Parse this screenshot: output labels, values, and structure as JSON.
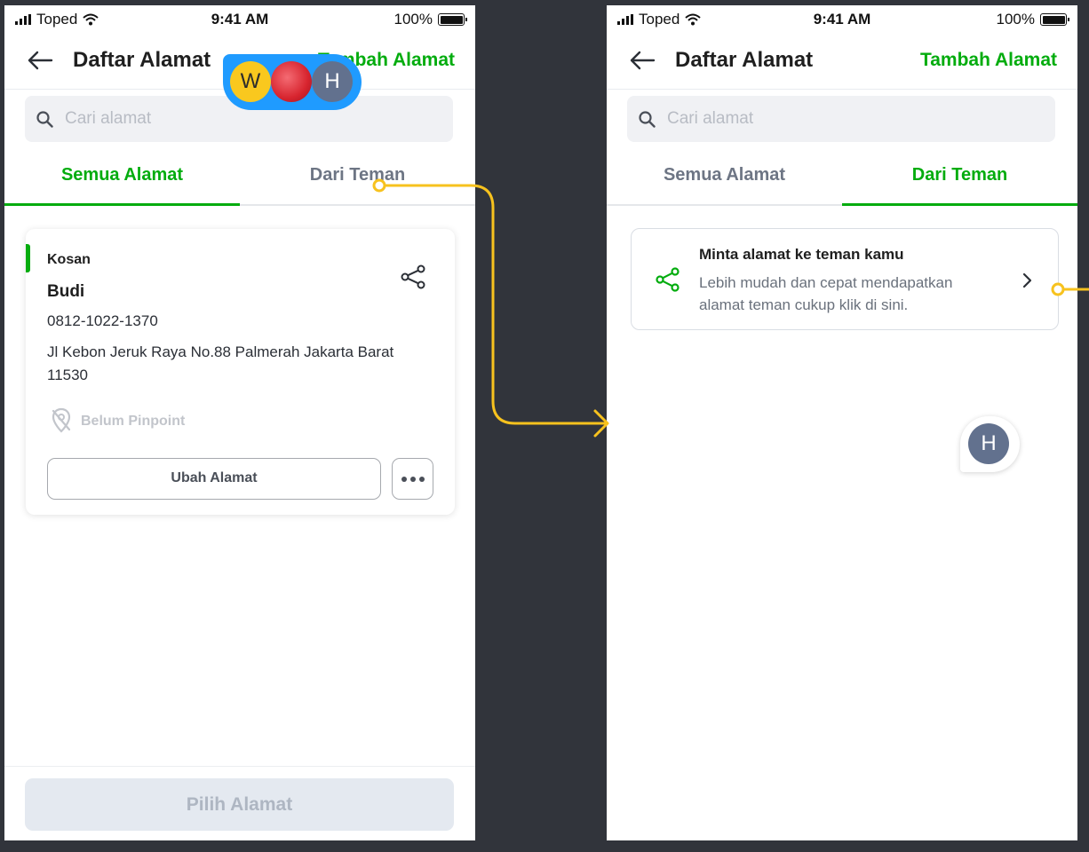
{
  "status_bar": {
    "carrier": "Toped",
    "time": "9:41 AM",
    "battery": "100%"
  },
  "screen1": {
    "title": "Daftar Alamat",
    "add_link": "Tambah Alamat",
    "search_placeholder": "Cari alamat",
    "tabs": [
      {
        "label": "Semua Alamat",
        "active": true
      },
      {
        "label": "Dari Teman",
        "active": false
      }
    ],
    "address_card": {
      "label": "Kosan",
      "name": "Budi",
      "phone": "0812-1022-1370",
      "street": "Jl Kebon Jeruk Raya No.88 Palmerah Jakarta Barat 11530",
      "pinpoint_status": "Belum Pinpoint",
      "edit_button": "Ubah Alamat"
    },
    "primary_button": "Pilih Alamat",
    "avatars": [
      "W",
      "",
      "H"
    ]
  },
  "screen2": {
    "title": "Daftar Alamat",
    "add_link": "Tambah Alamat",
    "search_placeholder": "Cari alamat",
    "tabs": [
      {
        "label": "Semua Alamat",
        "active": false
      },
      {
        "label": "Dari Teman",
        "active": true
      }
    ],
    "request_card": {
      "title": "Minta alamat ke teman kamu",
      "description": "Lebih mudah dan cepat mendapatkan alamat teman cukup klik di sini."
    },
    "floating_avatar": "H"
  },
  "colors": {
    "background": "#31343b",
    "brand_green": "#03ac0e",
    "flow_connector": "#f7c21e",
    "avatar_pill": "#1f9bff"
  }
}
